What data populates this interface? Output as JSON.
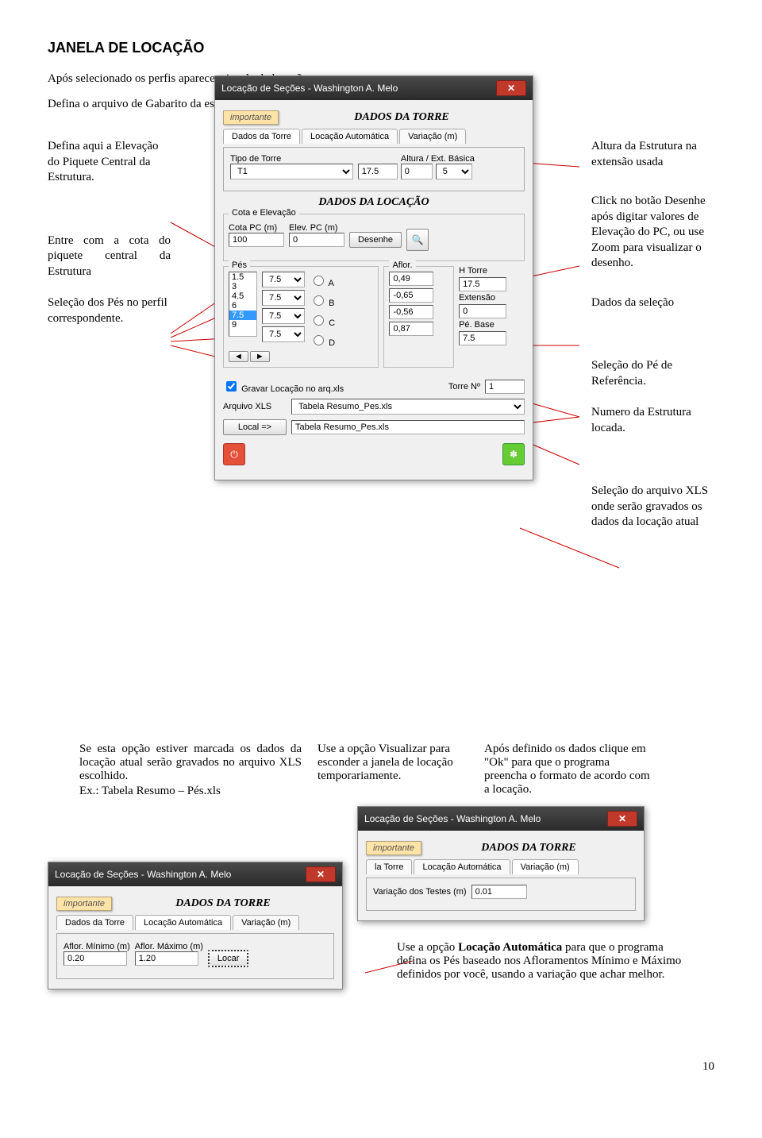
{
  "page": {
    "title": "JANELA DE LOCAÇÃO",
    "intro": "Após selecionado os perfis aparece a janela de locação.",
    "instruction": "Defina o arquivo de Gabarito da estrutura usando a caixa de seleção.",
    "page_number": "10"
  },
  "notes": {
    "l1": "Defina aqui a Elevação do Piquete Central da Estrutura.",
    "l2": "Entre com a cota do piquete central da Estrutura",
    "l3": "Seleção dos Pés no perfil correspondente.",
    "r1": "Altura da Estrutura na extensão usada",
    "r2": "Click no botão Desenhe após digitar valores de Elevação do PC, ou use Zoom para visualizar o desenho.",
    "r3": "Dados da seleção",
    "r4": "Seleção do Pé de Referência.",
    "r5": "Numero da Estrutura locada.",
    "r6": "Seleção do arquivo XLS onde serão gravados os dados da locação atual",
    "bl1": "Se esta opção estiver marcada os dados da locação atual serão gravados no arquivo XLS escolhido.",
    "bl1b": "Ex.: Tabela Resumo – Pés.xls",
    "bc1": "Use a opção Visualizar para esconder a janela de locação temporariamente.",
    "br1": "Após definido os dados clique em \"Ok\" para que o programa preencha o formato de acordo com a locação.",
    "auto": "Use a opção Locação Automática para que o programa defina os Pés baseado nos Afloramentos Mínimo e Máximo definidos por você, usando a variação que achar melhor.",
    "auto_bold": "Locação Automática"
  },
  "dlg": {
    "title": "Locação de Seções - Washington A. Melo",
    "importante": "importante",
    "header": "DADOS DA TORRE",
    "loc_header": "DADOS DA LOCAÇÃO",
    "tabs": {
      "t1": "Dados da Torre",
      "t2": "Locação Automática",
      "t3": "Variação (m)"
    },
    "tipo_lbl": "Tipo de Torre",
    "tipo_val": "T1",
    "altura_lbl": "Altura / Ext. Básica",
    "altura_v1": "17.5",
    "altura_v2": "0",
    "altura_v3": "5",
    "grp_cota": "Cota e Elevação",
    "cota_lbl": "Cota PC (m)",
    "cota_val": "100",
    "elev_lbl": "Elev. PC (m)",
    "elev_val": "0",
    "desenhe": "Desenhe",
    "pes_lbl": "Pés",
    "pes_items": [
      "1.5",
      "3",
      "4.5",
      "6",
      "7.5",
      "9"
    ],
    "aflor_lbl": "Aflor.",
    "htorre_lbl": "H Torre",
    "htorre_val": "17.5",
    "ext_lbl": "Extensão",
    "ext_val": "0",
    "pe_base_lbl": "Pé. Base",
    "pe_base_val": "7.5",
    "radio": {
      "a": "A",
      "b": "B",
      "c": "C",
      "d": "D"
    },
    "aflor_vals": {
      "a": "0,49",
      "b": "-0,65",
      "c": "-0,56",
      "d": "0,87"
    },
    "sel_vals": [
      "7.5",
      "7.5",
      "7.5",
      "7.5"
    ],
    "gravar_lbl": "Gravar Locação no arq.xls",
    "torre_no_lbl": "Torre Nº",
    "torre_no_val": "1",
    "arq_lbl": "Arquivo XLS",
    "arq_val": "Tabela Resumo_Pes.xls",
    "local_btn": "Local =>",
    "local_val": "Tabela Resumo_Pes.xls"
  },
  "dlg2": {
    "title": "Locação de Seções - Washington A. Melo",
    "importante": "importante",
    "header": "DADOS DA TORRE",
    "tabs": {
      "t1": "Dados da Torre",
      "t2": "Locação Automática",
      "t3": "Variação (m)"
    },
    "aflor_min_lbl": "Aflor. Mínimo (m)",
    "aflor_min_val": "0.20",
    "aflor_max_lbl": "Aflor. Máximo (m)",
    "aflor_max_val": "1.20",
    "locar_btn": "Locar",
    "var_lbl": "Variação dos Testes (m)",
    "var_val": "0.01",
    "tabs2": {
      "t1": "la Torre",
      "t2": "Locação Automática",
      "t3": "Variação (m)"
    }
  }
}
